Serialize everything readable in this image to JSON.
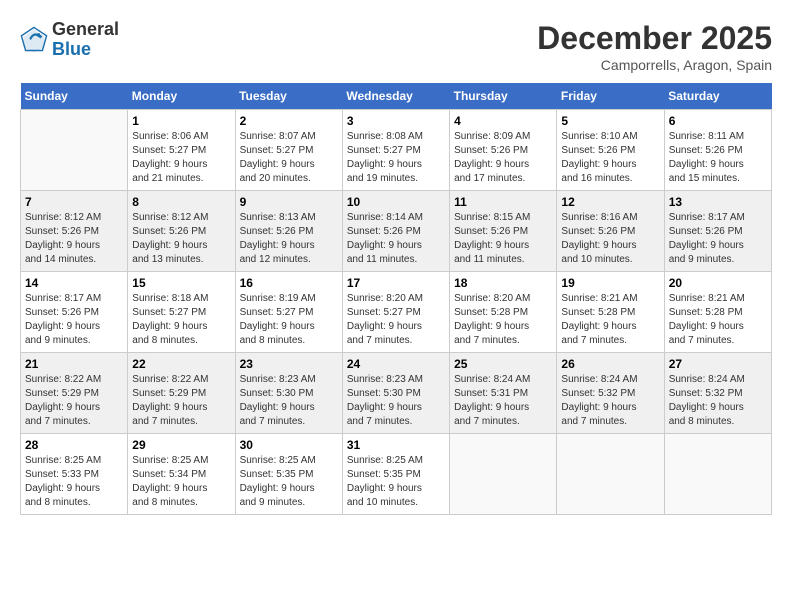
{
  "logo": {
    "general": "General",
    "blue": "Blue"
  },
  "header": {
    "month": "December 2025",
    "location": "Camporrells, Aragon, Spain"
  },
  "days_of_week": [
    "Sunday",
    "Monday",
    "Tuesday",
    "Wednesday",
    "Thursday",
    "Friday",
    "Saturday"
  ],
  "weeks": [
    [
      {
        "day": "",
        "info": ""
      },
      {
        "day": "1",
        "info": "Sunrise: 8:06 AM\nSunset: 5:27 PM\nDaylight: 9 hours\nand 21 minutes."
      },
      {
        "day": "2",
        "info": "Sunrise: 8:07 AM\nSunset: 5:27 PM\nDaylight: 9 hours\nand 20 minutes."
      },
      {
        "day": "3",
        "info": "Sunrise: 8:08 AM\nSunset: 5:27 PM\nDaylight: 9 hours\nand 19 minutes."
      },
      {
        "day": "4",
        "info": "Sunrise: 8:09 AM\nSunset: 5:26 PM\nDaylight: 9 hours\nand 17 minutes."
      },
      {
        "day": "5",
        "info": "Sunrise: 8:10 AM\nSunset: 5:26 PM\nDaylight: 9 hours\nand 16 minutes."
      },
      {
        "day": "6",
        "info": "Sunrise: 8:11 AM\nSunset: 5:26 PM\nDaylight: 9 hours\nand 15 minutes."
      }
    ],
    [
      {
        "day": "7",
        "info": "Sunrise: 8:12 AM\nSunset: 5:26 PM\nDaylight: 9 hours\nand 14 minutes."
      },
      {
        "day": "8",
        "info": "Sunrise: 8:12 AM\nSunset: 5:26 PM\nDaylight: 9 hours\nand 13 minutes."
      },
      {
        "day": "9",
        "info": "Sunrise: 8:13 AM\nSunset: 5:26 PM\nDaylight: 9 hours\nand 12 minutes."
      },
      {
        "day": "10",
        "info": "Sunrise: 8:14 AM\nSunset: 5:26 PM\nDaylight: 9 hours\nand 11 minutes."
      },
      {
        "day": "11",
        "info": "Sunrise: 8:15 AM\nSunset: 5:26 PM\nDaylight: 9 hours\nand 11 minutes."
      },
      {
        "day": "12",
        "info": "Sunrise: 8:16 AM\nSunset: 5:26 PM\nDaylight: 9 hours\nand 10 minutes."
      },
      {
        "day": "13",
        "info": "Sunrise: 8:17 AM\nSunset: 5:26 PM\nDaylight: 9 hours\nand 9 minutes."
      }
    ],
    [
      {
        "day": "14",
        "info": "Sunrise: 8:17 AM\nSunset: 5:26 PM\nDaylight: 9 hours\nand 9 minutes."
      },
      {
        "day": "15",
        "info": "Sunrise: 8:18 AM\nSunset: 5:27 PM\nDaylight: 9 hours\nand 8 minutes."
      },
      {
        "day": "16",
        "info": "Sunrise: 8:19 AM\nSunset: 5:27 PM\nDaylight: 9 hours\nand 8 minutes."
      },
      {
        "day": "17",
        "info": "Sunrise: 8:20 AM\nSunset: 5:27 PM\nDaylight: 9 hours\nand 7 minutes."
      },
      {
        "day": "18",
        "info": "Sunrise: 8:20 AM\nSunset: 5:28 PM\nDaylight: 9 hours\nand 7 minutes."
      },
      {
        "day": "19",
        "info": "Sunrise: 8:21 AM\nSunset: 5:28 PM\nDaylight: 9 hours\nand 7 minutes."
      },
      {
        "day": "20",
        "info": "Sunrise: 8:21 AM\nSunset: 5:28 PM\nDaylight: 9 hours\nand 7 minutes."
      }
    ],
    [
      {
        "day": "21",
        "info": "Sunrise: 8:22 AM\nSunset: 5:29 PM\nDaylight: 9 hours\nand 7 minutes."
      },
      {
        "day": "22",
        "info": "Sunrise: 8:22 AM\nSunset: 5:29 PM\nDaylight: 9 hours\nand 7 minutes."
      },
      {
        "day": "23",
        "info": "Sunrise: 8:23 AM\nSunset: 5:30 PM\nDaylight: 9 hours\nand 7 minutes."
      },
      {
        "day": "24",
        "info": "Sunrise: 8:23 AM\nSunset: 5:30 PM\nDaylight: 9 hours\nand 7 minutes."
      },
      {
        "day": "25",
        "info": "Sunrise: 8:24 AM\nSunset: 5:31 PM\nDaylight: 9 hours\nand 7 minutes."
      },
      {
        "day": "26",
        "info": "Sunrise: 8:24 AM\nSunset: 5:32 PM\nDaylight: 9 hours\nand 7 minutes."
      },
      {
        "day": "27",
        "info": "Sunrise: 8:24 AM\nSunset: 5:32 PM\nDaylight: 9 hours\nand 8 minutes."
      }
    ],
    [
      {
        "day": "28",
        "info": "Sunrise: 8:25 AM\nSunset: 5:33 PM\nDaylight: 9 hours\nand 8 minutes."
      },
      {
        "day": "29",
        "info": "Sunrise: 8:25 AM\nSunset: 5:34 PM\nDaylight: 9 hours\nand 8 minutes."
      },
      {
        "day": "30",
        "info": "Sunrise: 8:25 AM\nSunset: 5:35 PM\nDaylight: 9 hours\nand 9 minutes."
      },
      {
        "day": "31",
        "info": "Sunrise: 8:25 AM\nSunset: 5:35 PM\nDaylight: 9 hours\nand 10 minutes."
      },
      {
        "day": "",
        "info": ""
      },
      {
        "day": "",
        "info": ""
      },
      {
        "day": "",
        "info": ""
      }
    ]
  ]
}
